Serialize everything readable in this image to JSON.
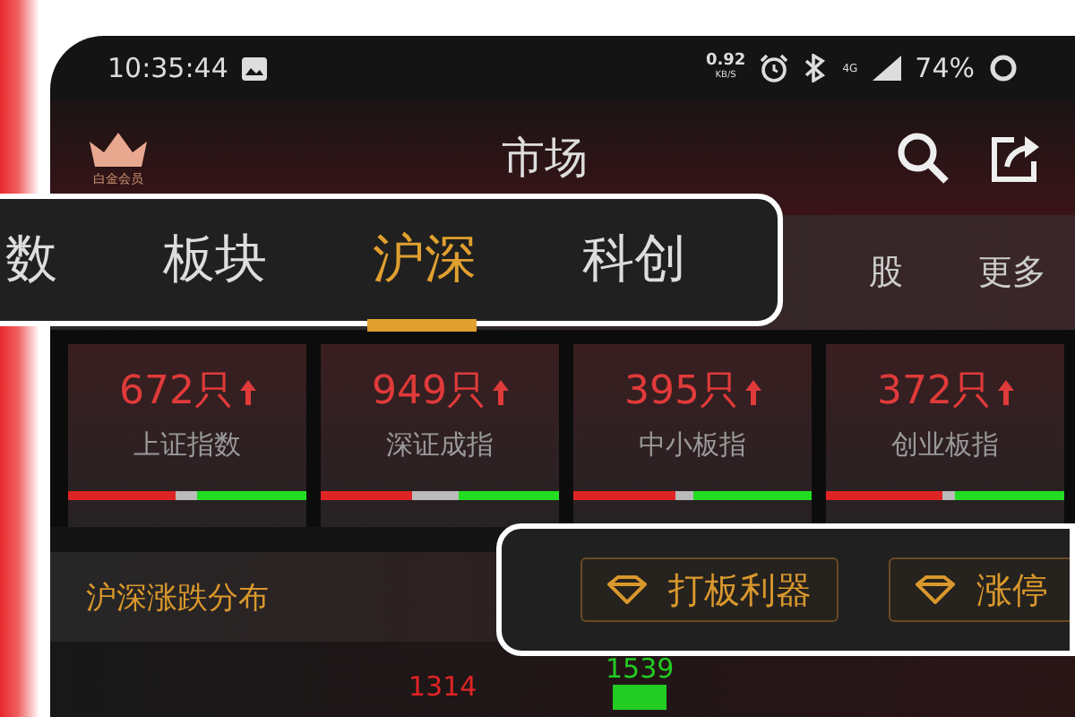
{
  "status_bar": {
    "time": "10:35:44",
    "net_speed": "0.92",
    "net_unit": "KB/S",
    "network": "4G",
    "battery": "74%"
  },
  "header": {
    "badge": "白金会员",
    "title": "市场"
  },
  "tabs": [
    {
      "label": "股",
      "selected": false
    },
    {
      "label": "更多",
      "selected": false
    }
  ],
  "tab_callout": [
    {
      "label": "数",
      "selected": false
    },
    {
      "label": "板块",
      "selected": false
    },
    {
      "label": "沪深",
      "selected": true
    },
    {
      "label": "科创",
      "selected": false
    }
  ],
  "cards": [
    {
      "count": "672只",
      "name": "上证指数",
      "breadth": {
        "color": "#22dd22",
        "segments": [
          {
            "level": 0.45,
            "color": "#e02424"
          },
          {
            "level": 0.54,
            "color": "#bbbbbb"
          }
        ]
      }
    },
    {
      "count": "949只",
      "name": "深证成指",
      "breadth": {
        "color": "#22dd22",
        "segments": [
          {
            "level": 0.38,
            "color": "#e02424"
          },
          {
            "level": 0.58,
            "color": "#bbbbbb"
          }
        ]
      }
    },
    {
      "count": "395只",
      "name": "中小板指",
      "breadth": {
        "color": "#22dd22",
        "segments": [
          {
            "level": 0.43,
            "color": "#e02424"
          },
          {
            "level": 0.5,
            "color": "#bbbbbb"
          }
        ]
      }
    },
    {
      "count": "372只",
      "name": "创业板指",
      "breadth": {
        "color": "#22dd22",
        "segments": [
          {
            "level": 0.49,
            "color": "#e02424"
          },
          {
            "level": 0.54,
            "color": "#bbbbbb"
          }
        ]
      }
    }
  ],
  "section": {
    "title": "沪深涨跌分布"
  },
  "tool_callout": [
    {
      "label": "打板利器"
    },
    {
      "label": "涨停"
    }
  ],
  "distribution": [
    {
      "label": "1314",
      "color": "#e02424",
      "bar": false
    },
    {
      "label": "1539",
      "color": "#22cc22",
      "bar": true
    }
  ]
}
